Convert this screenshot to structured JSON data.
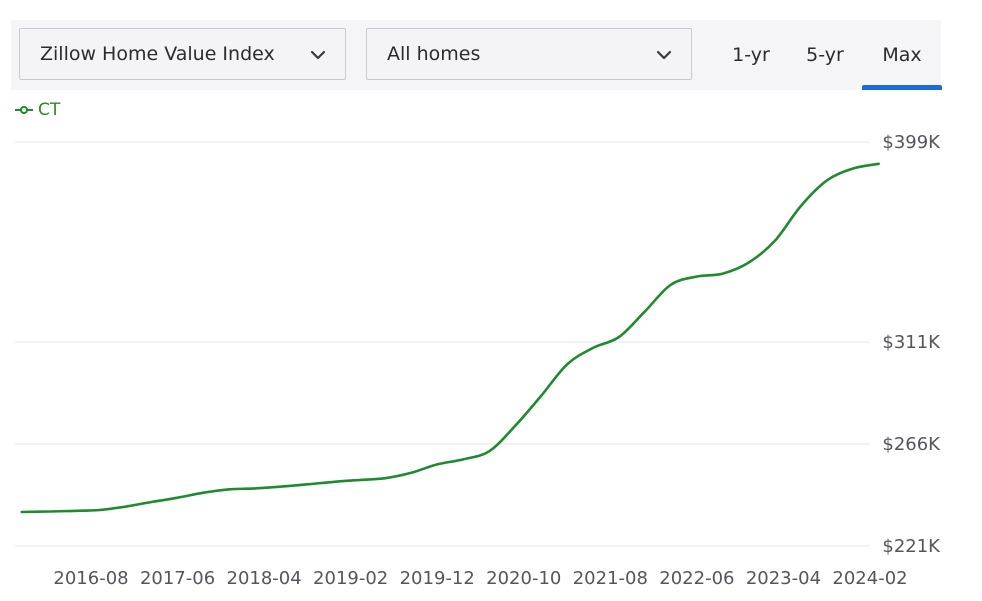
{
  "controls": {
    "metric_select": "Zillow Home Value Index",
    "home_type_select": "All homes",
    "tabs": [
      "1-yr",
      "5-yr",
      "Max"
    ],
    "active_tab": "Max"
  },
  "colors": {
    "series": "#1f8a2e",
    "active_tab": "#1a6bdc",
    "grid": "#e6e6ea"
  },
  "chart_data": {
    "type": "line",
    "title": "",
    "xlabel": "",
    "ylabel": "",
    "legend_position": "top-left",
    "grid": true,
    "x_ticks": [
      "2016-08",
      "2017-06",
      "2018-04",
      "2019-02",
      "2019-12",
      "2020-10",
      "2021-08",
      "2022-06",
      "2023-04",
      "2024-02"
    ],
    "y_ticks": [
      "$221K",
      "$266K",
      "$311K",
      "$399K"
    ],
    "y_tick_values": [
      221000,
      266000,
      311000,
      399000
    ],
    "ylim": [
      221000,
      399000
    ],
    "series": [
      {
        "name": "CT",
        "x": [
          "2015-12",
          "2016-03",
          "2016-06",
          "2016-09",
          "2016-12",
          "2017-03",
          "2017-06",
          "2017-09",
          "2017-12",
          "2018-03",
          "2018-06",
          "2018-09",
          "2018-12",
          "2019-03",
          "2019-06",
          "2019-09",
          "2019-12",
          "2020-03",
          "2020-06",
          "2020-09",
          "2020-12",
          "2021-03",
          "2021-06",
          "2021-09",
          "2021-12",
          "2022-03",
          "2022-06",
          "2022-09",
          "2022-12",
          "2023-03",
          "2023-06",
          "2023-09",
          "2023-12",
          "2024-03"
        ],
        "values": [
          236000,
          236200,
          236500,
          236900,
          238400,
          240400,
          242300,
          244500,
          246000,
          246400,
          247200,
          248200,
          249300,
          250100,
          250900,
          253300,
          257000,
          259200,
          262800,
          274000,
          287200,
          301100,
          308400,
          313200,
          324500,
          336200,
          339800,
          341100,
          346000,
          355500,
          370800,
          382000,
          387300,
          389400
        ]
      }
    ]
  }
}
